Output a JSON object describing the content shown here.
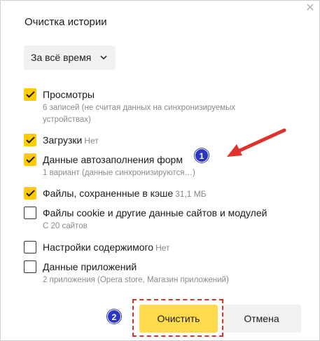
{
  "dialog": {
    "title": "Очистка истории",
    "close_glyph": "✕",
    "period": {
      "selected": "За всё время",
      "chevron": "⌄"
    }
  },
  "items": [
    {
      "label": "Просмотры",
      "meta": "",
      "sub": "6 записей (не считая данных на синхронизируемых устройствах)",
      "checked": true
    },
    {
      "label": "Загрузки",
      "meta": "Нет",
      "sub": "",
      "checked": true
    },
    {
      "label": "Данные автозаполнения форм",
      "meta": "",
      "sub": "1 вариант (данные синхронизируются…)",
      "checked": true
    },
    {
      "label": "Файлы, сохраненные в кэше",
      "meta": "31,1 МБ",
      "sub": "",
      "checked": true
    },
    {
      "label": "Файлы cookie и другие данные сайтов и модулей",
      "meta": "",
      "sub": "С 20 сайтов",
      "checked": false
    },
    {
      "label": "Настройки содержимого",
      "meta": "Нет",
      "sub": "",
      "checked": false
    },
    {
      "label": "Данные приложений",
      "meta": "",
      "sub": "2 приложения (Opera store, Магазин приложений)",
      "checked": false
    }
  ],
  "buttons": {
    "clear": "Очистить",
    "cancel": "Отмена"
  },
  "annotations": {
    "badge1": "1",
    "badge2": "2"
  },
  "colors": {
    "accent": "#ffdb4d",
    "checkbox": "#ffcc00",
    "badge": "#2c36c4",
    "highlight": "#e0322a"
  }
}
